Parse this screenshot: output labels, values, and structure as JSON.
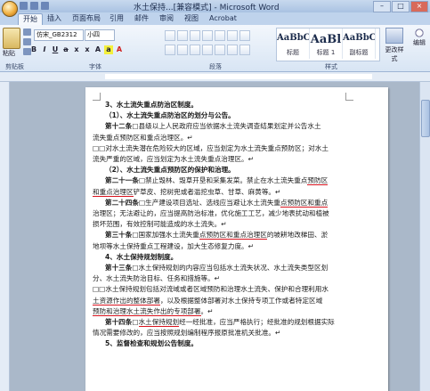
{
  "window": {
    "title": "水土保持...[兼容模式] - Microsoft Word"
  },
  "tabs": [
    "开始",
    "插入",
    "页面布局",
    "引用",
    "邮件",
    "审阅",
    "视图",
    "Acrobat"
  ],
  "ribbon": {
    "paste_label": "粘贴",
    "font_name": "仿宋_GB2312",
    "font_size": "小四",
    "groups": {
      "clipboard": "剪贴板",
      "font": "字体",
      "paragraph": "段落",
      "styles": "样式",
      "editing": "编辑"
    },
    "styles": [
      {
        "sample": "AaBbC",
        "name": "标题"
      },
      {
        "sample": "AaBl",
        "name": "标题 1"
      },
      {
        "sample": "AaBbC",
        "name": "副标题"
      }
    ],
    "change_styles": "更改样式"
  },
  "document": {
    "lines": [
      {
        "cls": "h",
        "segments": [
          {
            "t": "3、水土流失重点防治区制度。"
          }
        ]
      },
      {
        "cls": "h",
        "segments": [
          {
            "t": "（1）、水土流失重点防治区的划分与公告。"
          }
        ]
      },
      {
        "cls": "ind",
        "segments": [
          {
            "t": "第十二条",
            "b": true
          },
          {
            "t": "□县级以上人民政府应当依据水土流失调查结果划定并公告水土"
          }
        ]
      },
      {
        "cls": "",
        "segments": [
          {
            "t": "流失重点预防区和重点治理区。↵"
          }
        ]
      },
      {
        "cls": "",
        "segments": [
          {
            "t": "□□对水土流失潜在危险较大的区域，应当划定为水土流失重点预防区；对水土"
          }
        ]
      },
      {
        "cls": "",
        "segments": [
          {
            "t": "流失严重的区域，应当划定为水土流失重点治理区。↵"
          }
        ]
      },
      {
        "cls": "h",
        "segments": [
          {
            "t": "（2）、水土流失重点预防区的保护和治理。"
          }
        ]
      },
      {
        "cls": "ind",
        "segments": [
          {
            "t": "第二十一条",
            "b": true
          },
          {
            "t": "□禁止毁林、毁草开垦和采集发菜。禁止在水土流失重点"
          },
          {
            "t": "预防区",
            "u": true
          }
        ]
      },
      {
        "cls": "",
        "segments": [
          {
            "t": "和重点治理区",
            "u": true
          },
          {
            "t": "铲草皮、挖树兜或者滥挖虫草、甘草、麻黄等。↵"
          }
        ]
      },
      {
        "cls": "ind",
        "segments": [
          {
            "t": "第二十四条",
            "b": true
          },
          {
            "t": "□生产建设项目选址、选线应当避让水土流失重"
          },
          {
            "t": "点预防区和重点",
            "u": true
          }
        ]
      },
      {
        "cls": "",
        "segments": [
          {
            "t": "治理区；无法避让的，应当提高防治标准，优化施工工艺，减少地表扰动和植被"
          }
        ]
      },
      {
        "cls": "",
        "segments": [
          {
            "t": "损坏范围，有效控制可能造成的水土流失。↵"
          }
        ]
      },
      {
        "cls": "ind",
        "segments": [
          {
            "t": "第三十条",
            "b": true
          },
          {
            "t": "□国家加强水土流失重"
          },
          {
            "t": "点预防区和重点治理区",
            "u": true
          },
          {
            "t": "的坡耕地改梯田、淤"
          }
        ]
      },
      {
        "cls": "",
        "segments": [
          {
            "t": "地坝等水土保持重点工程建设，加大生态修复力度。↵"
          }
        ]
      },
      {
        "cls": "h",
        "segments": [
          {
            "t": "4、水土保持规划制度。"
          }
        ]
      },
      {
        "cls": "ind",
        "segments": [
          {
            "t": "第十三条",
            "b": true
          },
          {
            "t": "□水土保持规划的内容应当包括水土流失状况、水土流失类型区划"
          }
        ]
      },
      {
        "cls": "",
        "segments": [
          {
            "t": "分、水土流失防治目标、任务和措施等。↵"
          }
        ]
      },
      {
        "cls": "",
        "segments": [
          {
            "t": "□□水土保持规划包括对流域或者区域预防和治理水土流失、保护和合理利用水"
          }
        ]
      },
      {
        "cls": "",
        "segments": [
          {
            "t": "土资源作出的整体部署",
            "u": true
          },
          {
            "t": "，以及根据整体部署对水土保持专项工作或者特定区域"
          }
        ]
      },
      {
        "cls": "",
        "segments": [
          {
            "t": "预防和治理水土流失作出的专项部署",
            "u": true
          },
          {
            "t": "。↵"
          }
        ]
      },
      {
        "cls": "ind",
        "segments": [
          {
            "t": "第十四条",
            "b": true
          },
          {
            "t": "□"
          },
          {
            "t": "水土保持规划",
            "u": true
          },
          {
            "t": "经一经批准，应当严格执行；经批准的规划根据实际"
          }
        ]
      },
      {
        "cls": "",
        "segments": [
          {
            "t": "情况需要修改的，应当按照规划编制程序报原批准机关批准。↵"
          }
        ]
      },
      {
        "cls": "h",
        "segments": [
          {
            "t": "5、监督检查和规划公告制度。"
          }
        ]
      }
    ]
  }
}
